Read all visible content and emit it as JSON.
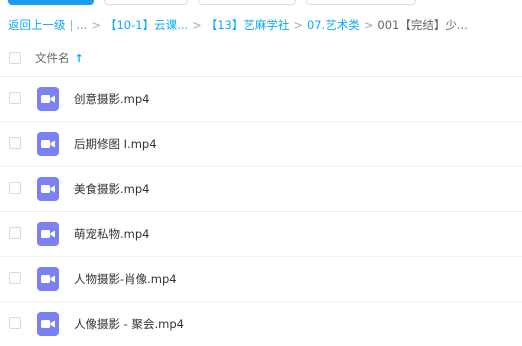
{
  "breadcrumb": {
    "back": "返回上一级",
    "divider": "|",
    "ellipsis": "...",
    "items": [
      "【10-1】云课...",
      "【13】艺麻学社",
      "07.艺术类"
    ],
    "separator": ">",
    "current": "001【完结】少..."
  },
  "list_header": {
    "column_name": "文件名",
    "sort_icon": "arrow-up-icon"
  },
  "files": [
    {
      "name": "创意摄影.mp4",
      "icon": "video-file-icon"
    },
    {
      "name": "后期修图 I.mp4",
      "icon": "video-file-icon"
    },
    {
      "name": "美食摄影.mp4",
      "icon": "video-file-icon"
    },
    {
      "name": "萌宠私物.mp4",
      "icon": "video-file-icon"
    },
    {
      "name": "人物摄影-肖像.mp4",
      "icon": "video-file-icon"
    },
    {
      "name": "人像摄影 - 聚会.mp4",
      "icon": "video-file-icon"
    }
  ],
  "colors": {
    "accent": "#09aaff",
    "icon_purple": "#7b80f2"
  }
}
